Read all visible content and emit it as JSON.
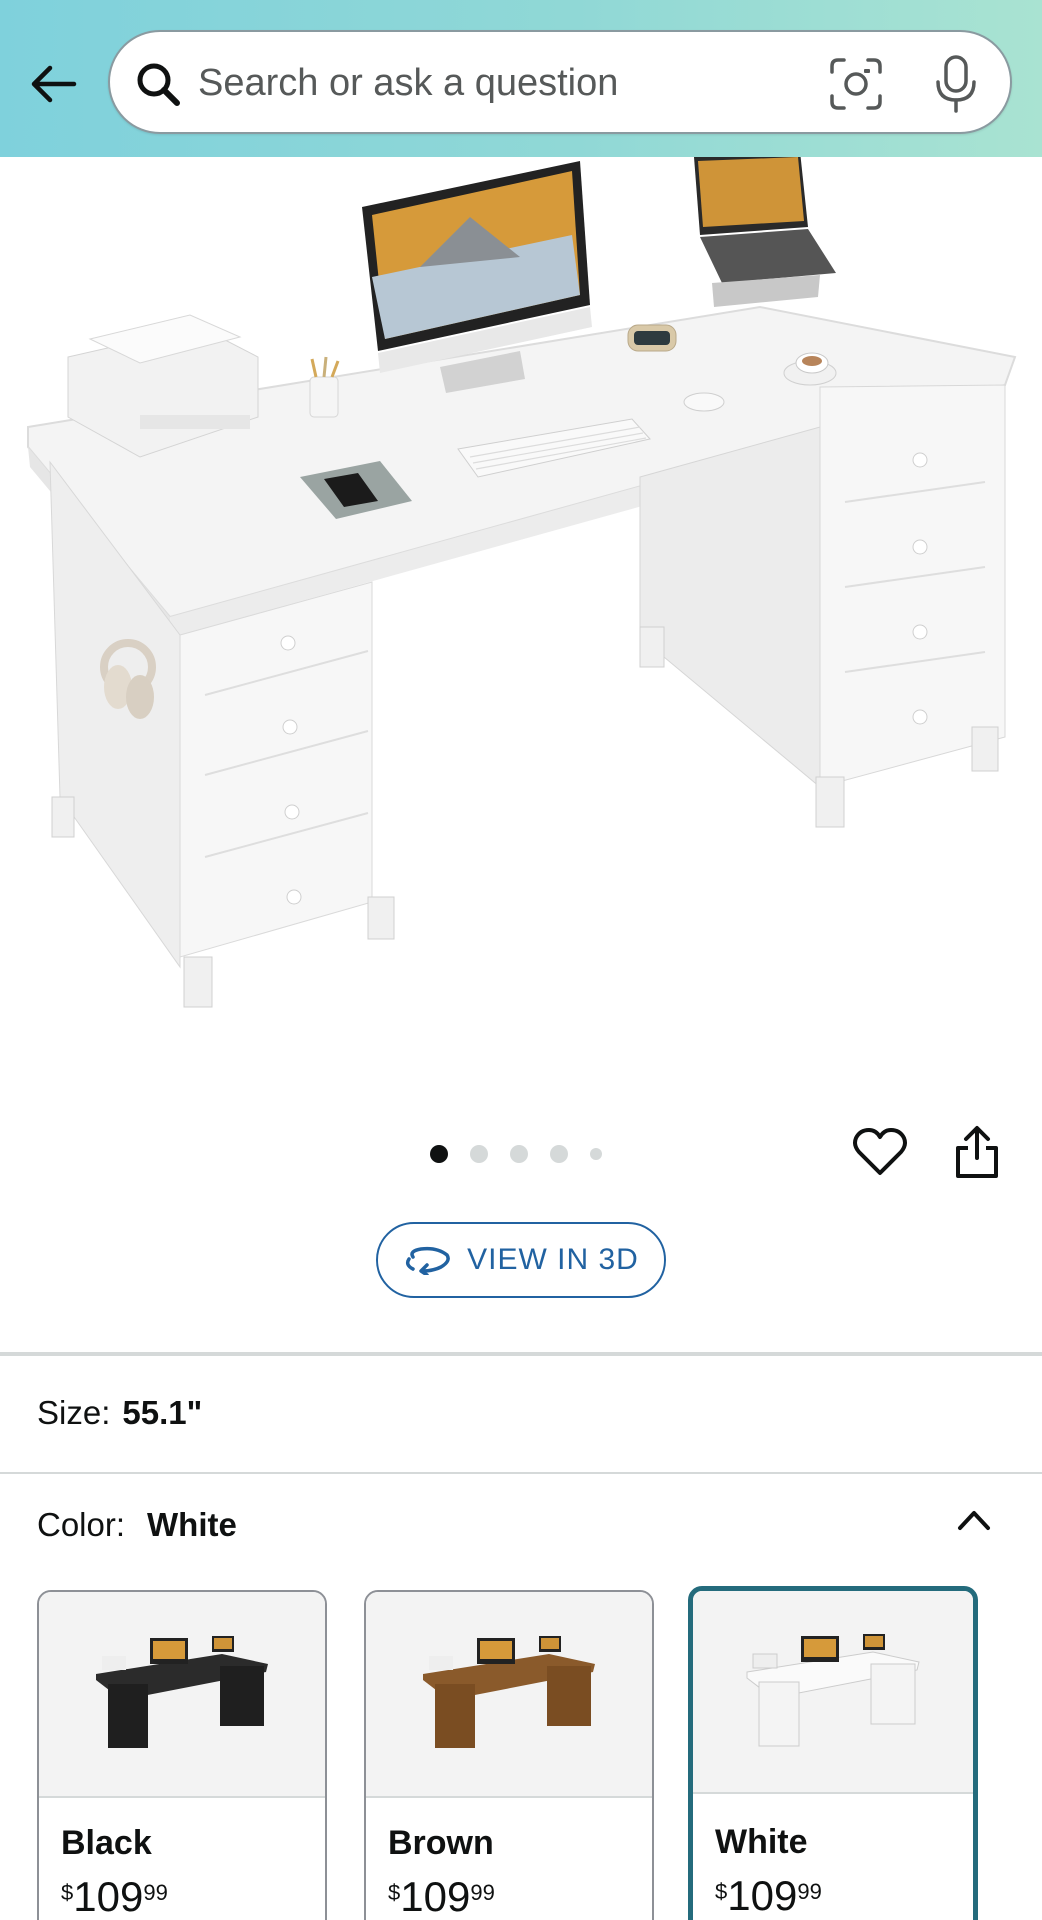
{
  "header": {
    "search_placeholder": "Search or ask a question"
  },
  "carousel": {
    "total_images": 5,
    "active_index": 0
  },
  "view3d": {
    "label": "VIEW IN 3D"
  },
  "size": {
    "label": "Size:",
    "value": "55.1\""
  },
  "color": {
    "label": "Color:",
    "value": "White",
    "options": [
      {
        "name": "Black",
        "currency": "$",
        "price_whole": "109",
        "price_cents": "99",
        "selected": false,
        "desk_color": "#2b2b2b"
      },
      {
        "name": "Brown",
        "currency": "$",
        "price_whole": "109",
        "price_cents": "99",
        "selected": false,
        "desk_color": "#8a5a2b"
      },
      {
        "name": "White",
        "currency": "$",
        "price_whole": "109",
        "price_cents": "99",
        "selected": true,
        "desk_color": "#fafafa"
      }
    ]
  },
  "colors": {
    "link_blue": "#2162a1",
    "selected_border": "#246b7c",
    "header_start": "#7fd1dc",
    "header_end": "#a9e3d2"
  }
}
